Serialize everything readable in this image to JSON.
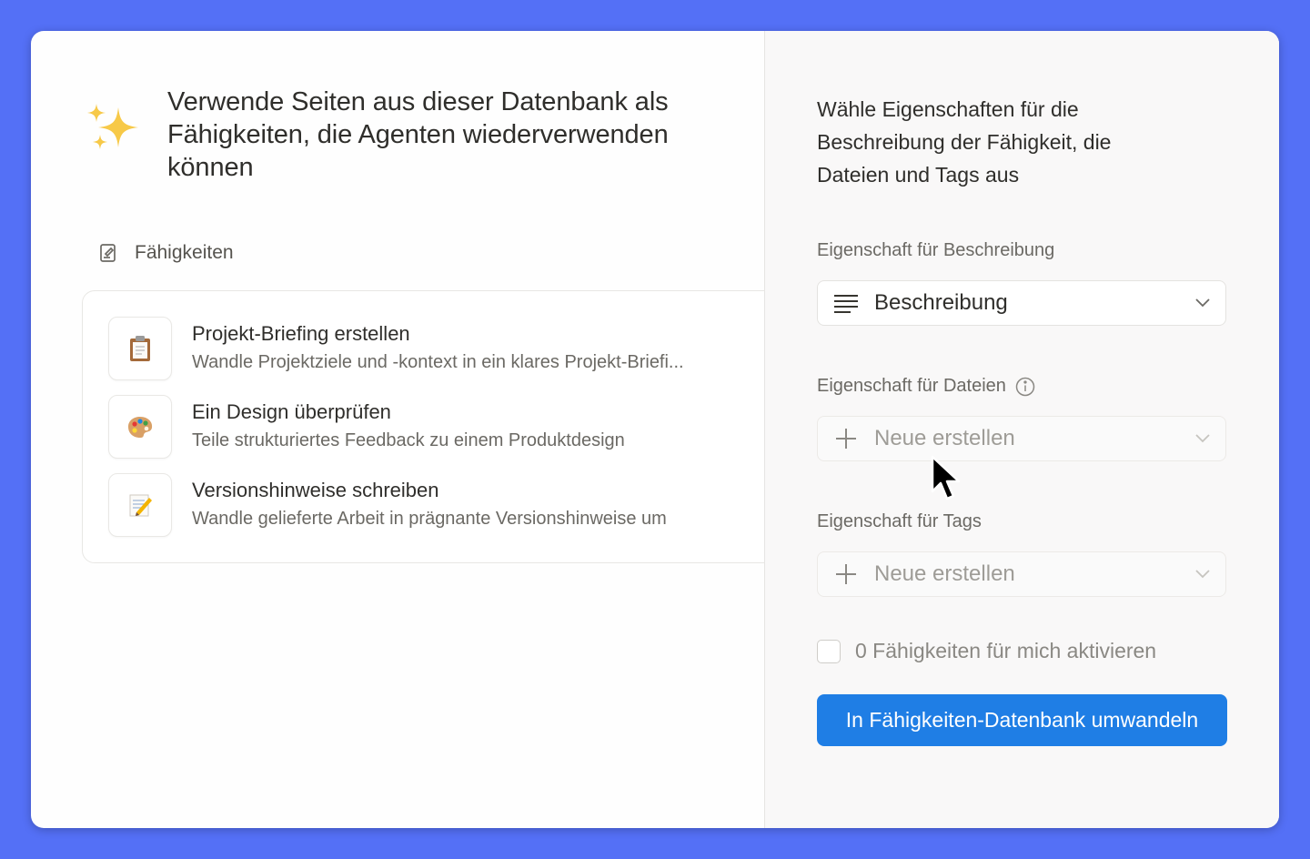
{
  "left": {
    "title": "Verwende Seiten aus dieser Datenbank als Fähigkeiten, die Agenten wiederverwenden können",
    "database_label": "Fähigkeiten",
    "items": [
      {
        "icon": "clipboard-icon",
        "title": "Projekt-Briefing erstellen",
        "description": "Wandle Projektziele und -kontext in ein klares Projekt-Briefi..."
      },
      {
        "icon": "palette-icon",
        "title": "Ein Design überprüfen",
        "description": "Teile strukturiertes Feedback zu einem Produktdesign"
      },
      {
        "icon": "memo-icon",
        "title": "Versionshinweise schreiben",
        "description": "Wandle gelieferte Arbeit in prägnante Versionshinweise um"
      }
    ]
  },
  "right": {
    "heading": "Wähle Eigenschaften für die Beschreibung der Fähigkeit, die Dateien und Tags aus",
    "description_label": "Eigenschaft für Beschreibung",
    "description_value": "Beschreibung",
    "files_label": "Eigenschaft für Dateien",
    "files_value": "Neue erstellen",
    "tags_label": "Eigenschaft für Tags",
    "tags_value": "Neue erstellen",
    "checkbox_label": "0 Fähigkeiten für mich aktivieren",
    "checkbox_checked": false,
    "convert_button": "In Fähigkeiten-Datenbank umwandeln"
  },
  "colors": {
    "background": "#5470f6",
    "primary_button": "#1f7ee5"
  }
}
